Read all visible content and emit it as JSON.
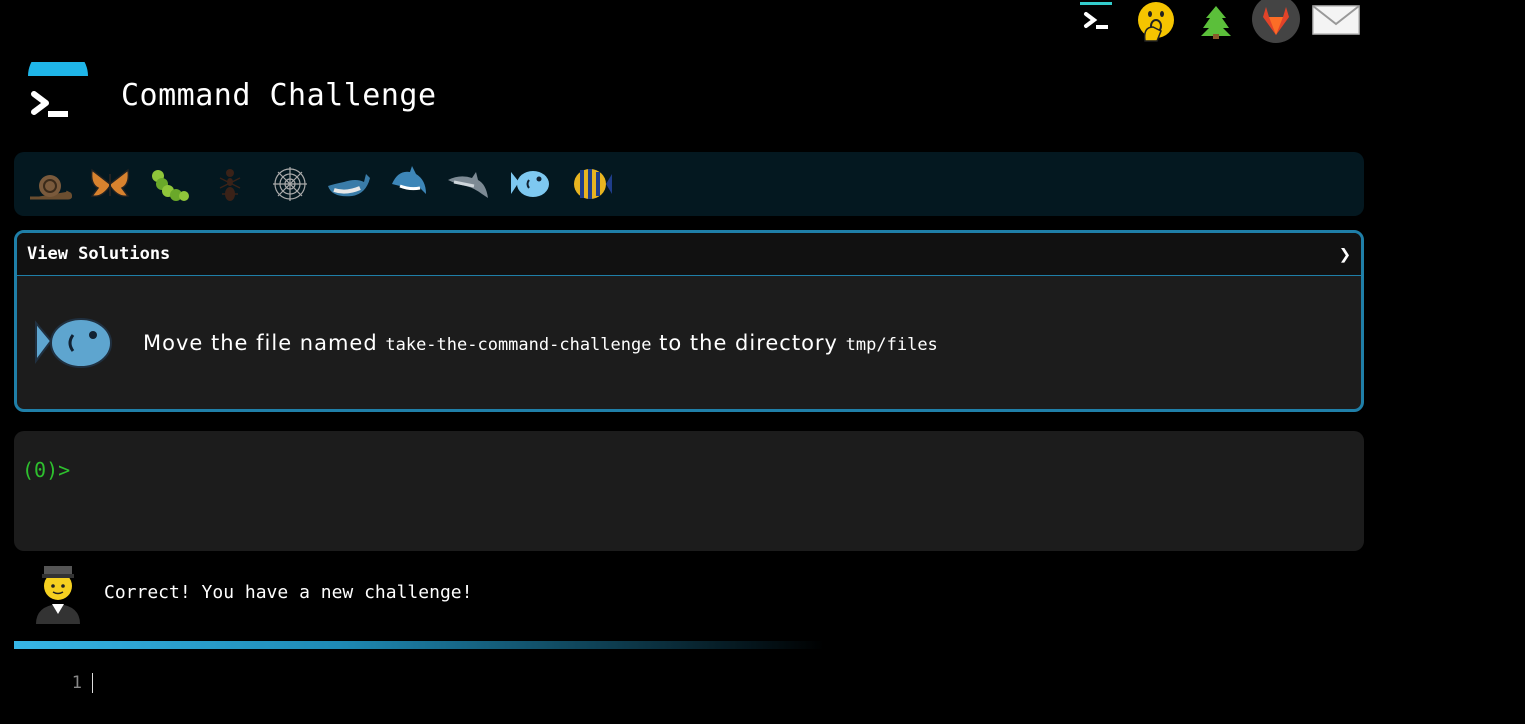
{
  "nav": {
    "icons": [
      "terminal-icon",
      "hushed-face-icon",
      "tree-icon",
      "gitlab-icon",
      "envelope-icon"
    ]
  },
  "header": {
    "title": "Command Challenge"
  },
  "levels": {
    "icons": [
      "snail-icon",
      "butterfly-icon",
      "caterpillar-icon",
      "ant-icon",
      "spider-web-icon",
      "whale-icon",
      "shark-icon",
      "dolphin-icon",
      "blowfish-icon",
      "tropical-fish-icon"
    ]
  },
  "challenge": {
    "toggle_label": "View Solutions",
    "chevron": "❯",
    "text_before": "Move the file named ",
    "file_name": "take-the-command-challenge",
    "text_middle": " to the directory ",
    "dir_name": "tmp/files"
  },
  "terminal": {
    "prompt": "(0)>"
  },
  "feedback": {
    "message": "Correct! You have a new challenge!"
  },
  "editor": {
    "line_number": "1"
  },
  "colors": {
    "accent": "#1f7fa8",
    "prompt": "#2ec02e",
    "progress": "#37b6e6"
  }
}
